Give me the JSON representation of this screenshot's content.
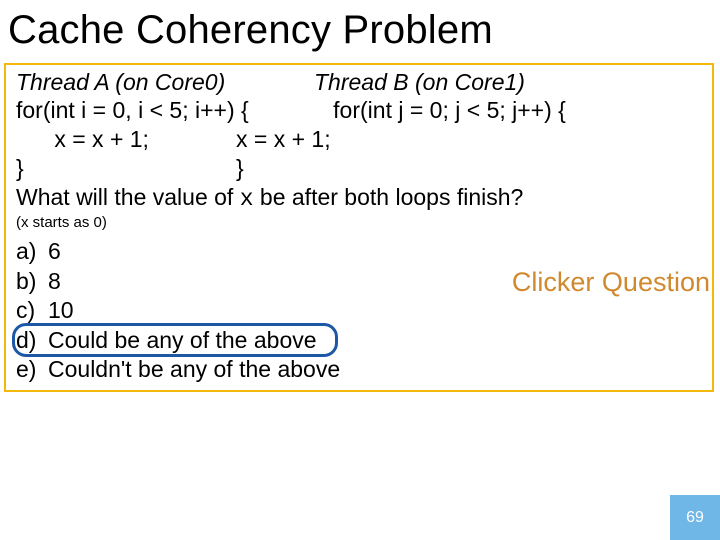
{
  "title": "Cache Coherency Problem",
  "threadA": {
    "header": "Thread A (on Core0)",
    "line1": "for(int i = 0, i < 5; i++) {",
    "line2_indent": "      x = x + 1;",
    "line3": "}"
  },
  "threadB": {
    "header": "Thread B (on Core1)",
    "line1_indent": "   for(int j = 0; j < 5; j++) {",
    "line2": "x = x + 1;",
    "line3": "}"
  },
  "question_pre": "What will the value of ",
  "question_var": "x",
  "question_post": " be after both loops finish?",
  "note": "(x starts as 0)",
  "options": {
    "a": {
      "label": "a)",
      "text": "6"
    },
    "b": {
      "label": "b)",
      "text": "8"
    },
    "c": {
      "label": "c)",
      "text": "10"
    },
    "d": {
      "label": "d)",
      "text": "Could be any of the above"
    },
    "e": {
      "label": "e)",
      "text": "Couldn't be any of the above"
    }
  },
  "clicker_label": "Clicker Question",
  "page_number": "69"
}
